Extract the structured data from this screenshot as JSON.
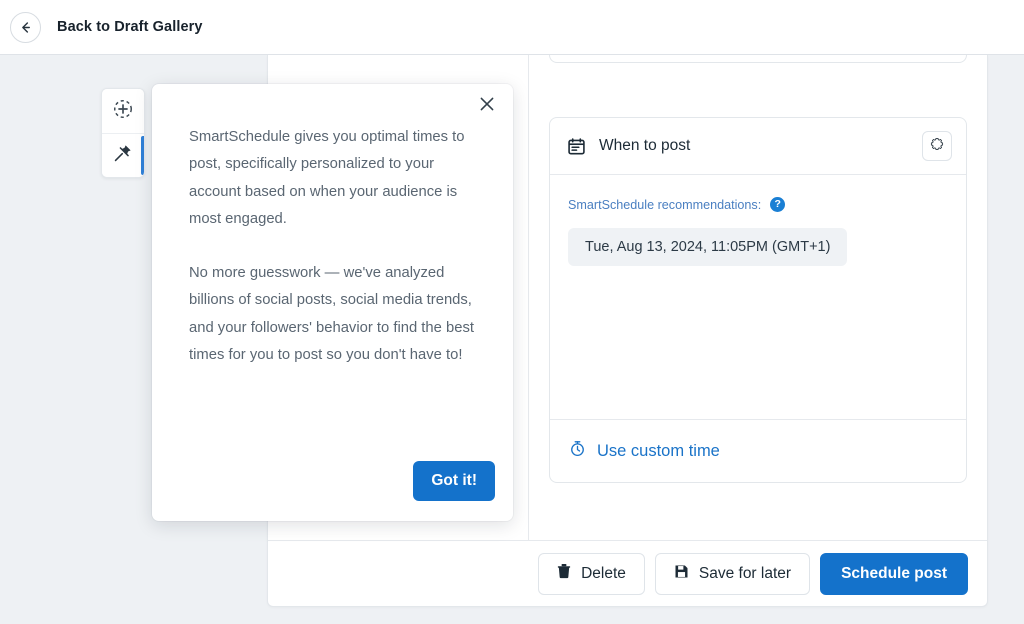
{
  "topbar": {
    "back_icon": "arrow-left-icon",
    "title": "Back to Draft Gallery"
  },
  "side_toolbar": {
    "items": [
      {
        "icon": "add-circle-dashed-icon",
        "name": "add-post-tool",
        "active": false
      },
      {
        "icon": "pin-icon",
        "name": "pin-tool",
        "active": true
      }
    ]
  },
  "popover": {
    "close_icon": "close-icon",
    "paragraph_1": "SmartSchedule gives you optimal times to post, specifically personalized to your account based on when your audience is most engaged.",
    "paragraph_2": "No more guesswork — we've analyzed billions of social posts, social media trends, and your followers' behavior to find the best times for you to post so you don't have to!",
    "confirm_label": "Got it!",
    "accent_color": "#1472cb"
  },
  "when_to_post": {
    "header_icon": "calendar-icon",
    "title": "When to post",
    "settings_icon": "gear-icon",
    "recommendations_label": "SmartSchedule recommendations:",
    "help_icon": "help-circle-icon",
    "help_glyph": "?",
    "recommendation_time": "Tue, Aug 13, 2024, 11:05PM (GMT+1)",
    "custom_time_icon": "stopwatch-icon",
    "custom_time_label": "Use custom time",
    "link_color": "#1a73c8"
  },
  "footer": {
    "delete_icon": "trash-icon",
    "delete_label": "Delete",
    "save_icon": "save-icon",
    "save_label": "Save for later",
    "schedule_label": "Schedule post",
    "primary_color": "#1472cb"
  }
}
